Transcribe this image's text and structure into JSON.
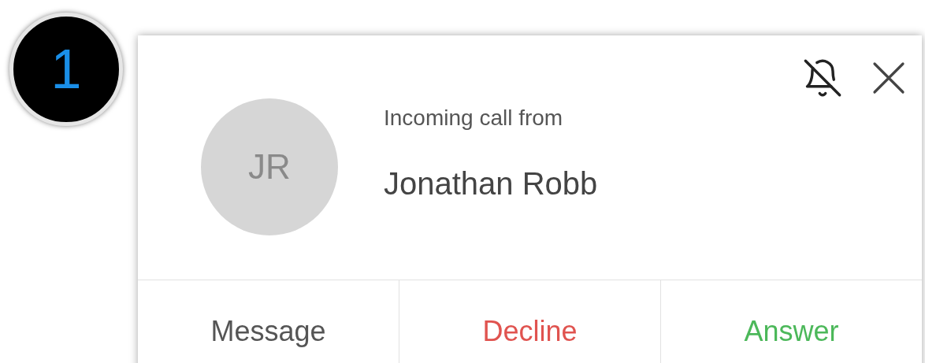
{
  "step_badge": "1",
  "call_card": {
    "avatar_initials": "JR",
    "caption": "Incoming call from",
    "caller": "Jonathan Robb",
    "actions": [
      {
        "label": "Message",
        "kind": "neutral"
      },
      {
        "label": "Decline",
        "kind": "decline"
      },
      {
        "label": "Answer",
        "kind": "answer"
      }
    ]
  }
}
